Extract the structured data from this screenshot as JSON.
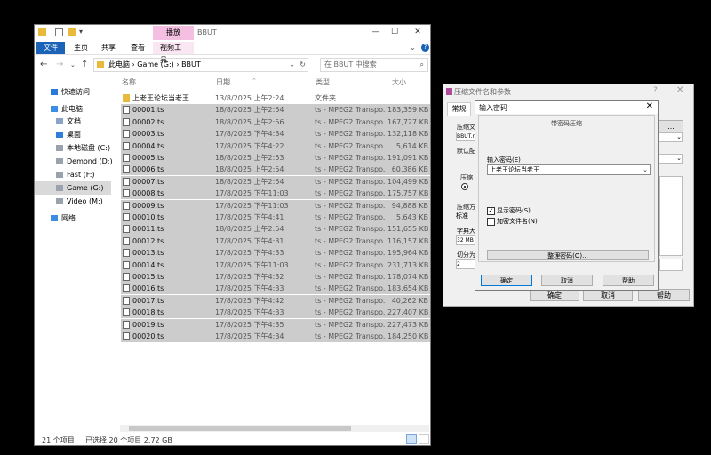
{
  "explorer": {
    "title": "BBUT",
    "context_tab": "播放",
    "ribbon_tabs": [
      "文件",
      "主页",
      "共享",
      "查看",
      "视频工具"
    ],
    "address": "此电脑 › Game (G:) › BBUT",
    "search_placeholder": "在 BBUT 中搜索",
    "sidebar": [
      {
        "label": "快速访问",
        "icon": "star-icon"
      },
      {
        "label": "此电脑",
        "icon": "computer-icon"
      },
      {
        "label": "文档",
        "icon": "document-icon"
      },
      {
        "label": "桌面",
        "icon": "desktop-icon"
      },
      {
        "label": "本地磁盘 (C:)",
        "icon": "drive-icon"
      },
      {
        "label": "Demond (D:)",
        "icon": "drive-icon"
      },
      {
        "label": "Fast (F:)",
        "icon": "drive-icon"
      },
      {
        "label": "Game (G:)",
        "icon": "drive-icon"
      },
      {
        "label": "Video (M:)",
        "icon": "drive-icon"
      },
      {
        "label": "网络",
        "icon": "network-icon"
      }
    ],
    "columns": [
      "名称",
      "日期",
      "类型",
      "大小"
    ],
    "files": [
      {
        "name": "上老王论坛当老王",
        "date": "13/8/2025 上午2:24",
        "type": "文件夹",
        "size": "",
        "folder": true
      },
      {
        "name": "00001.ts",
        "date": "18/8/2025 上午2:54",
        "type": "ts - MPEG2 Transpo...",
        "size": "183,359 KB"
      },
      {
        "name": "00002.ts",
        "date": "18/8/2025 上午2:56",
        "type": "ts - MPEG2 Transpo...",
        "size": "167,727 KB"
      },
      {
        "name": "00003.ts",
        "date": "17/8/2025 下午4:34",
        "type": "ts - MPEG2 Transpo...",
        "size": "132,118 KB"
      },
      {
        "name": "00004.ts",
        "date": "17/8/2025 下午4:22",
        "type": "ts - MPEG2 Transpo...",
        "size": "5,614 KB"
      },
      {
        "name": "00005.ts",
        "date": "18/8/2025 上午2:53",
        "type": "ts - MPEG2 Transpo...",
        "size": "191,091 KB"
      },
      {
        "name": "00006.ts",
        "date": "18/8/2025 上午2:54",
        "type": "ts - MPEG2 Transpo...",
        "size": "60,386 KB"
      },
      {
        "name": "00007.ts",
        "date": "18/8/2025 上午2:54",
        "type": "ts - MPEG2 Transpo...",
        "size": "104,499 KB"
      },
      {
        "name": "00008.ts",
        "date": "17/8/2025 下午11:03",
        "type": "ts - MPEG2 Transpo...",
        "size": "175,757 KB"
      },
      {
        "name": "00009.ts",
        "date": "17/8/2025 下午11:03",
        "type": "ts - MPEG2 Transpo...",
        "size": "94,888 KB"
      },
      {
        "name": "00010.ts",
        "date": "17/8/2025 下午4:41",
        "type": "ts - MPEG2 Transpo...",
        "size": "5,643 KB"
      },
      {
        "name": "00011.ts",
        "date": "18/8/2025 上午2:54",
        "type": "ts - MPEG2 Transpo...",
        "size": "151,655 KB"
      },
      {
        "name": "00012.ts",
        "date": "17/8/2025 下午4:31",
        "type": "ts - MPEG2 Transpo...",
        "size": "116,157 KB"
      },
      {
        "name": "00013.ts",
        "date": "17/8/2025 下午4:33",
        "type": "ts - MPEG2 Transpo...",
        "size": "195,964 KB"
      },
      {
        "name": "00014.ts",
        "date": "17/8/2025 下午11:03",
        "type": "ts - MPEG2 Transpo...",
        "size": "231,713 KB"
      },
      {
        "name": "00015.ts",
        "date": "17/8/2025 下午4:32",
        "type": "ts - MPEG2 Transpo...",
        "size": "178,074 KB"
      },
      {
        "name": "00016.ts",
        "date": "17/8/2025 下午4:33",
        "type": "ts - MPEG2 Transpo...",
        "size": "183,654 KB"
      },
      {
        "name": "00017.ts",
        "date": "17/8/2025 下午4:42",
        "type": "ts - MPEG2 Transpo...",
        "size": "40,262 KB"
      },
      {
        "name": "00018.ts",
        "date": "17/8/2025 下午4:33",
        "type": "ts - MPEG2 Transpo...",
        "size": "227,407 KB"
      },
      {
        "name": "00019.ts",
        "date": "17/8/2025 下午4:35",
        "type": "ts - MPEG2 Transpo...",
        "size": "227,473 KB"
      },
      {
        "name": "00020.ts",
        "date": "17/8/2025 下午4:34",
        "type": "ts - MPEG2 Transpo...",
        "size": "184,250 KB"
      }
    ],
    "status_count": "21 个项目",
    "status_selected": "已选择 20 个项目  2.72 GB"
  },
  "archive_dialog": {
    "title": "压缩文件名和参数",
    "tab": "常规",
    "labels": [
      "压缩文",
      "默认配",
      "压缩方",
      "字典大",
      "切分为"
    ],
    "name_value": "BBUT.r",
    "method_value": "标准",
    "dict_value": "32 MB",
    "split_value": "2",
    "group_label": "压缩",
    "ok": "确定",
    "cancel": "取消",
    "help": "帮助"
  },
  "password_dialog": {
    "title": "输入密码",
    "heading": "带密码压缩",
    "input_label": "输入密码(E)",
    "password_value": "上老王论坛当老王",
    "show_password": "显示密码(S)",
    "encrypt_names": "加密文件名(N)",
    "organize": "整理密码(O)...",
    "ok": "确定",
    "cancel": "取消",
    "help": "帮助"
  }
}
